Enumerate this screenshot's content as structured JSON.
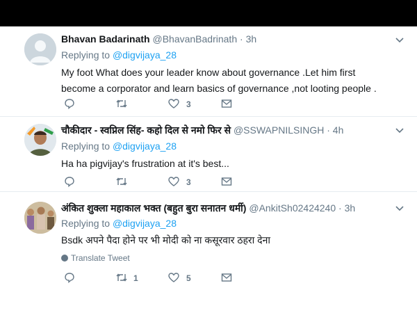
{
  "tweets": [
    {
      "name": "Bhavan Badarinath",
      "handle": "@BhavanBadrinath",
      "separator": "·",
      "time": "3h",
      "replying_prefix": "Replying to",
      "replying_to": "@digvijaya_28",
      "text": "My foot What does your leader know about governance .Let him first become a corporator and learn basics of governance ,not looting people .",
      "reply_count": "",
      "retweet_count": "",
      "like_count": "3"
    },
    {
      "name": "चौकीदार - स्वप्निल सिंह- कहो दिल से नमो फिर से",
      "handle": "@SSWAPNILSINGH",
      "separator": "·",
      "time": "4h",
      "replying_prefix": "Replying to",
      "replying_to": "@digvijaya_28",
      "text": "Ha ha pigvijay's frustration at it's best...",
      "reply_count": "",
      "retweet_count": "",
      "like_count": "3"
    },
    {
      "name": "अंकित शुक्ला महाकाल भक्त (बहुत बुरा सनातन धर्मी)",
      "handle": "@AnkitSh02424240",
      "separator": "·",
      "time": "3h",
      "replying_prefix": "Replying to",
      "replying_to": "@digvijaya_28",
      "text": "Bsdk अपने पैदा होने पर भी मोदी को ना कसूरवार ठहरा देना",
      "translate_label": "Translate Tweet",
      "reply_count": "",
      "retweet_count": "1",
      "like_count": "5"
    }
  ],
  "icons": {
    "reply": "reply-icon",
    "retweet": "retweet-icon",
    "like": "heart-icon",
    "dm": "envelope-icon",
    "more": "chevron-down-icon",
    "translate": "globe-icon"
  },
  "colors": {
    "link": "#1da1f2",
    "secondary": "#657786",
    "divider": "#e6ecf0"
  }
}
